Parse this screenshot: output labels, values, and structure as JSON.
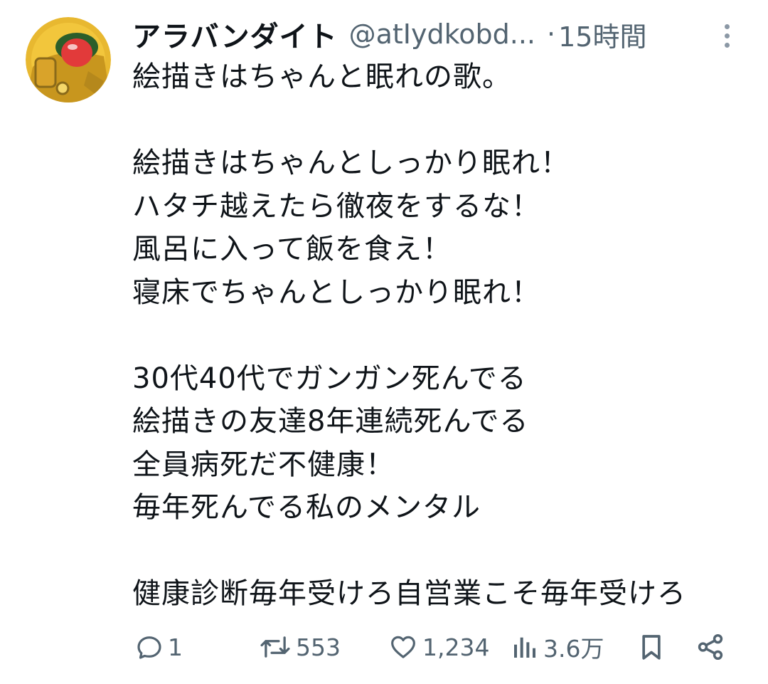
{
  "tweet": {
    "author": {
      "display_name": "アラバンダイト",
      "handle": "@atIydkobd...",
      "avatar_icon": "avatar-robot-image"
    },
    "separator": "·",
    "time": "15時間",
    "body_lines": [
      "絵描きはちゃんと眠れの歌。",
      "",
      "絵描きはちゃんとしっかり眠れ！",
      "ハタチ越えたら徹夜をするな！",
      "風呂に入って飯を食え！",
      "寝床でちゃんとしっかり眠れ！",
      "",
      "30代40代でガンガン死んでる",
      "絵描きの友達8年連続死んでる",
      "全員病死だ不健康！",
      "毎年死んでる私のメンタル",
      "",
      "健康診断毎年受けろ自営業こそ毎年受けろ"
    ],
    "actions": {
      "reply": {
        "icon": "reply-icon",
        "count": "1"
      },
      "retweet": {
        "icon": "retweet-icon",
        "count": "553"
      },
      "like": {
        "icon": "heart-icon",
        "count": "1,234"
      },
      "views": {
        "icon": "views-icon",
        "count": "3.6万"
      },
      "bookmark": {
        "icon": "bookmark-icon"
      },
      "share": {
        "icon": "share-icon"
      }
    },
    "colors": {
      "text": "#0f1419",
      "muted": "#536471",
      "more_dots": "#8b98a5"
    }
  }
}
